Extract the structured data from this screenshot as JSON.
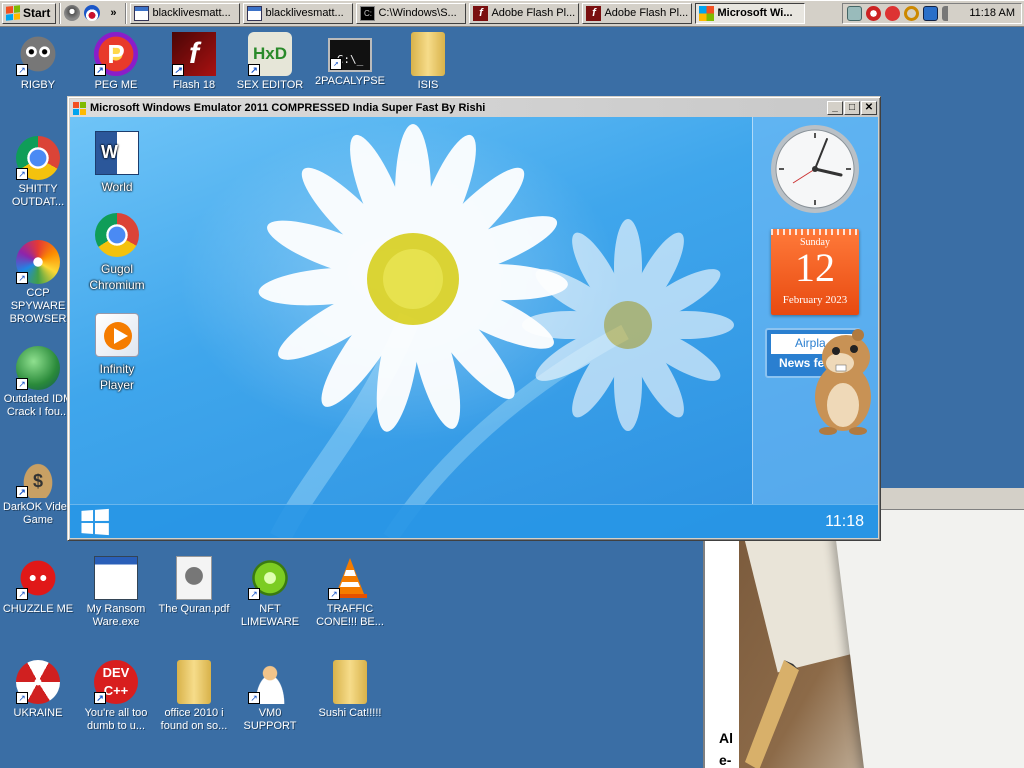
{
  "taskbar": {
    "start_label": "Start",
    "chevron": "»",
    "tasks": [
      {
        "label": "blacklivesmatt...",
        "icon": "window-icon",
        "active": false
      },
      {
        "label": "blacklivesmatt...",
        "icon": "window-icon",
        "active": false
      },
      {
        "label": "C:\\Windows\\S...",
        "icon": "cmd-icon",
        "active": false
      },
      {
        "label": "Adobe Flash Pl...",
        "icon": "flash-icon",
        "active": false
      },
      {
        "label": "Adobe Flash Pl...",
        "icon": "flash-icon",
        "active": false
      },
      {
        "label": "Microsoft Wi...",
        "icon": "windows-flag-icon",
        "active": true
      }
    ],
    "clock": "11:18 AM"
  },
  "desktop_icons": [
    {
      "label": "RIGBY",
      "icon": "raccoon-icon"
    },
    {
      "label": "PEG ME",
      "icon": "peggle-icon"
    },
    {
      "label": "Flash 18",
      "icon": "flash-icon"
    },
    {
      "label": "SEX EDITOR",
      "icon": "hex-editor-icon"
    },
    {
      "label": "2PACALYPSE",
      "icon": "terminal-icon"
    },
    {
      "label": "ISIS",
      "icon": "folder-icon"
    },
    {
      "label": "SHITTY OUTDAT...",
      "icon": "chrome-icon"
    },
    {
      "label": "CCP SPYWARE BROWSER",
      "icon": "pinwheel-icon"
    },
    {
      "label": "Outdated IDM Crack I fou...",
      "icon": "globe-download-icon"
    },
    {
      "label": "DarkOK Video Game",
      "icon": "money-bag-icon"
    },
    {
      "label": "CHUZZLE ME",
      "icon": "chuzzle-icon"
    },
    {
      "label": "My Ransom Ware.exe",
      "icon": "program-window-icon"
    },
    {
      "label": "The Quran.pdf",
      "icon": "raccoon-doc-icon"
    },
    {
      "label": "NFT LIMEWARE",
      "icon": "lime-icon"
    },
    {
      "label": "TRAFFIC CONE!!! BE...",
      "icon": "traffic-cone-icon"
    },
    {
      "label": "UKRAINE",
      "icon": "radiation-icon"
    },
    {
      "label": "You're all too dumb to u...",
      "icon": "dev-cpp-icon"
    },
    {
      "label": "office 2010 i found on so...",
      "icon": "folder-icon"
    },
    {
      "label": "VM0 SUPPORT",
      "icon": "support-person-icon"
    },
    {
      "label": "Sushi Cat!!!!!",
      "icon": "folder-icon"
    }
  ],
  "emulator": {
    "title": "Microsoft Windows Emulator 2011 COMPRESSED India Super Fast By Rishi",
    "icons": [
      {
        "label": "World",
        "icon": "word-icon"
      },
      {
        "label": "Gugol Chromium",
        "icon": "chromium-icon"
      },
      {
        "label": "Infinity Player",
        "icon": "media-player-icon"
      }
    ],
    "calendar": {
      "day_name": "Sunday",
      "day": "12",
      "month_year": "February 2023"
    },
    "news_widget": {
      "top": "Airpla",
      "bottom": "News fee"
    },
    "taskbar_time": "11:18"
  },
  "background_window": {
    "text1": "Al",
    "text2": "e-"
  },
  "colors": {
    "desktop": "#3a6ea5",
    "win8_accent": "#2b8fe0",
    "calendar": "#f25a1c"
  }
}
